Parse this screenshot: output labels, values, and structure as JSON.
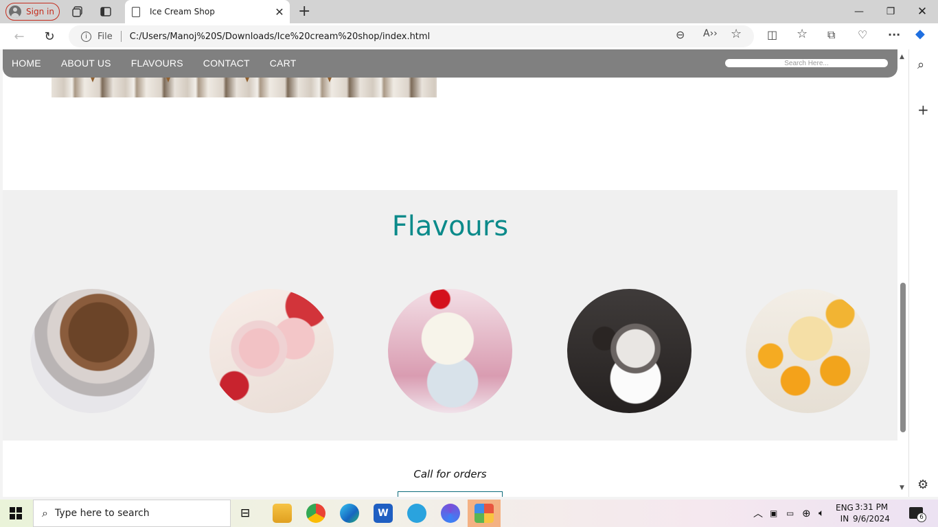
{
  "browser": {
    "signin_label": "Sign in",
    "tab_title": "Ice Cream Shop",
    "omnibox_scheme": "File",
    "url": "C:/Users/Manoj%20S/Downloads/Ice%20cream%20shop/index.html"
  },
  "site": {
    "nav": [
      "HOME",
      "ABOUT US",
      "FLAVOURS",
      "CONTACT",
      "CART"
    ],
    "search_placeholder": "Search Here...",
    "flavours_heading": "Flavours",
    "flavours": [
      {
        "icon": "chocolate-ice-cream-image"
      },
      {
        "icon": "strawberry-ice-cream-image"
      },
      {
        "icon": "vanilla-ice-cream-image"
      },
      {
        "icon": "cookies-and-cream-ice-cream-image"
      },
      {
        "icon": "mango-ice-cream-image"
      }
    ],
    "orders_label": "Call for orders",
    "accent_color": "#0b8a8a",
    "nav_color": "#808080"
  },
  "taskbar": {
    "search_placeholder": "Type here to search",
    "lang_line1": "ENG",
    "lang_line2": "IN",
    "time": "3:31 PM",
    "date": "9/6/2024",
    "notification_count": "6"
  }
}
